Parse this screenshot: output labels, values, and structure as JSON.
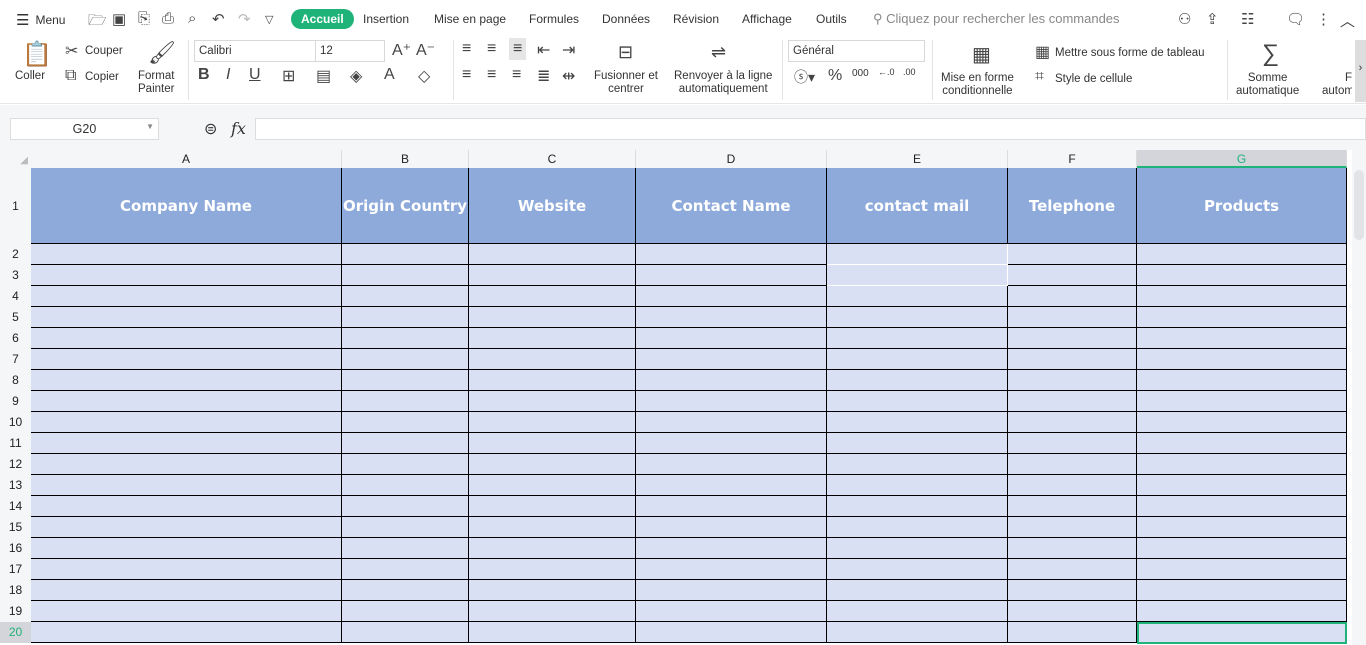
{
  "menu": {
    "label": "Menu"
  },
  "tabs": [
    "Accueil",
    "Insertion",
    "Mise en page",
    "Formules",
    "Données",
    "Révision",
    "Affichage",
    "Outils"
  ],
  "search": {
    "placeholder": "Cliquez pour rechercher les commandes"
  },
  "ribbon": {
    "coller": "Coller",
    "couper": "Couper",
    "copier": "Copier",
    "format_painter_1": "Format",
    "format_painter_2": "Painter",
    "font": "Calibri",
    "size": "12",
    "fusionner_1": "Fusionner et",
    "fusionner_2": "centrer",
    "renvoyer_1": "Renvoyer à la ligne",
    "renvoyer_2": "automatiquement",
    "number_format": "Général",
    "mise_forme_1": "Mise en forme",
    "mise_forme_2": "conditionnelle",
    "mettre_tableau": "Mettre sous forme de tableau",
    "style_cellule": "Style de cellule",
    "somme_1": "Somme",
    "somme_2": "automatique",
    "f_1": "F",
    "f_2": "autom"
  },
  "formula_bar": {
    "name_box": "G20",
    "fx": "fx",
    "value": ""
  },
  "sheet": {
    "columns": [
      "A",
      "B",
      "C",
      "D",
      "E",
      "F",
      "G"
    ],
    "headers": [
      "Company Name",
      "Origin Country",
      "Website",
      "Contact Name",
      "contact mail",
      "Telephone",
      "Products"
    ],
    "rows": [
      "1",
      "2",
      "3",
      "4",
      "5",
      "6",
      "7",
      "8",
      "9",
      "10",
      "11",
      "12",
      "13",
      "14",
      "15",
      "16",
      "17",
      "18",
      "19",
      "20"
    ],
    "selected_cell": "G20",
    "colors": {
      "header_fill": "#8eaadb",
      "body_fill": "#dae0f3",
      "selection": "#1fb37a"
    }
  }
}
